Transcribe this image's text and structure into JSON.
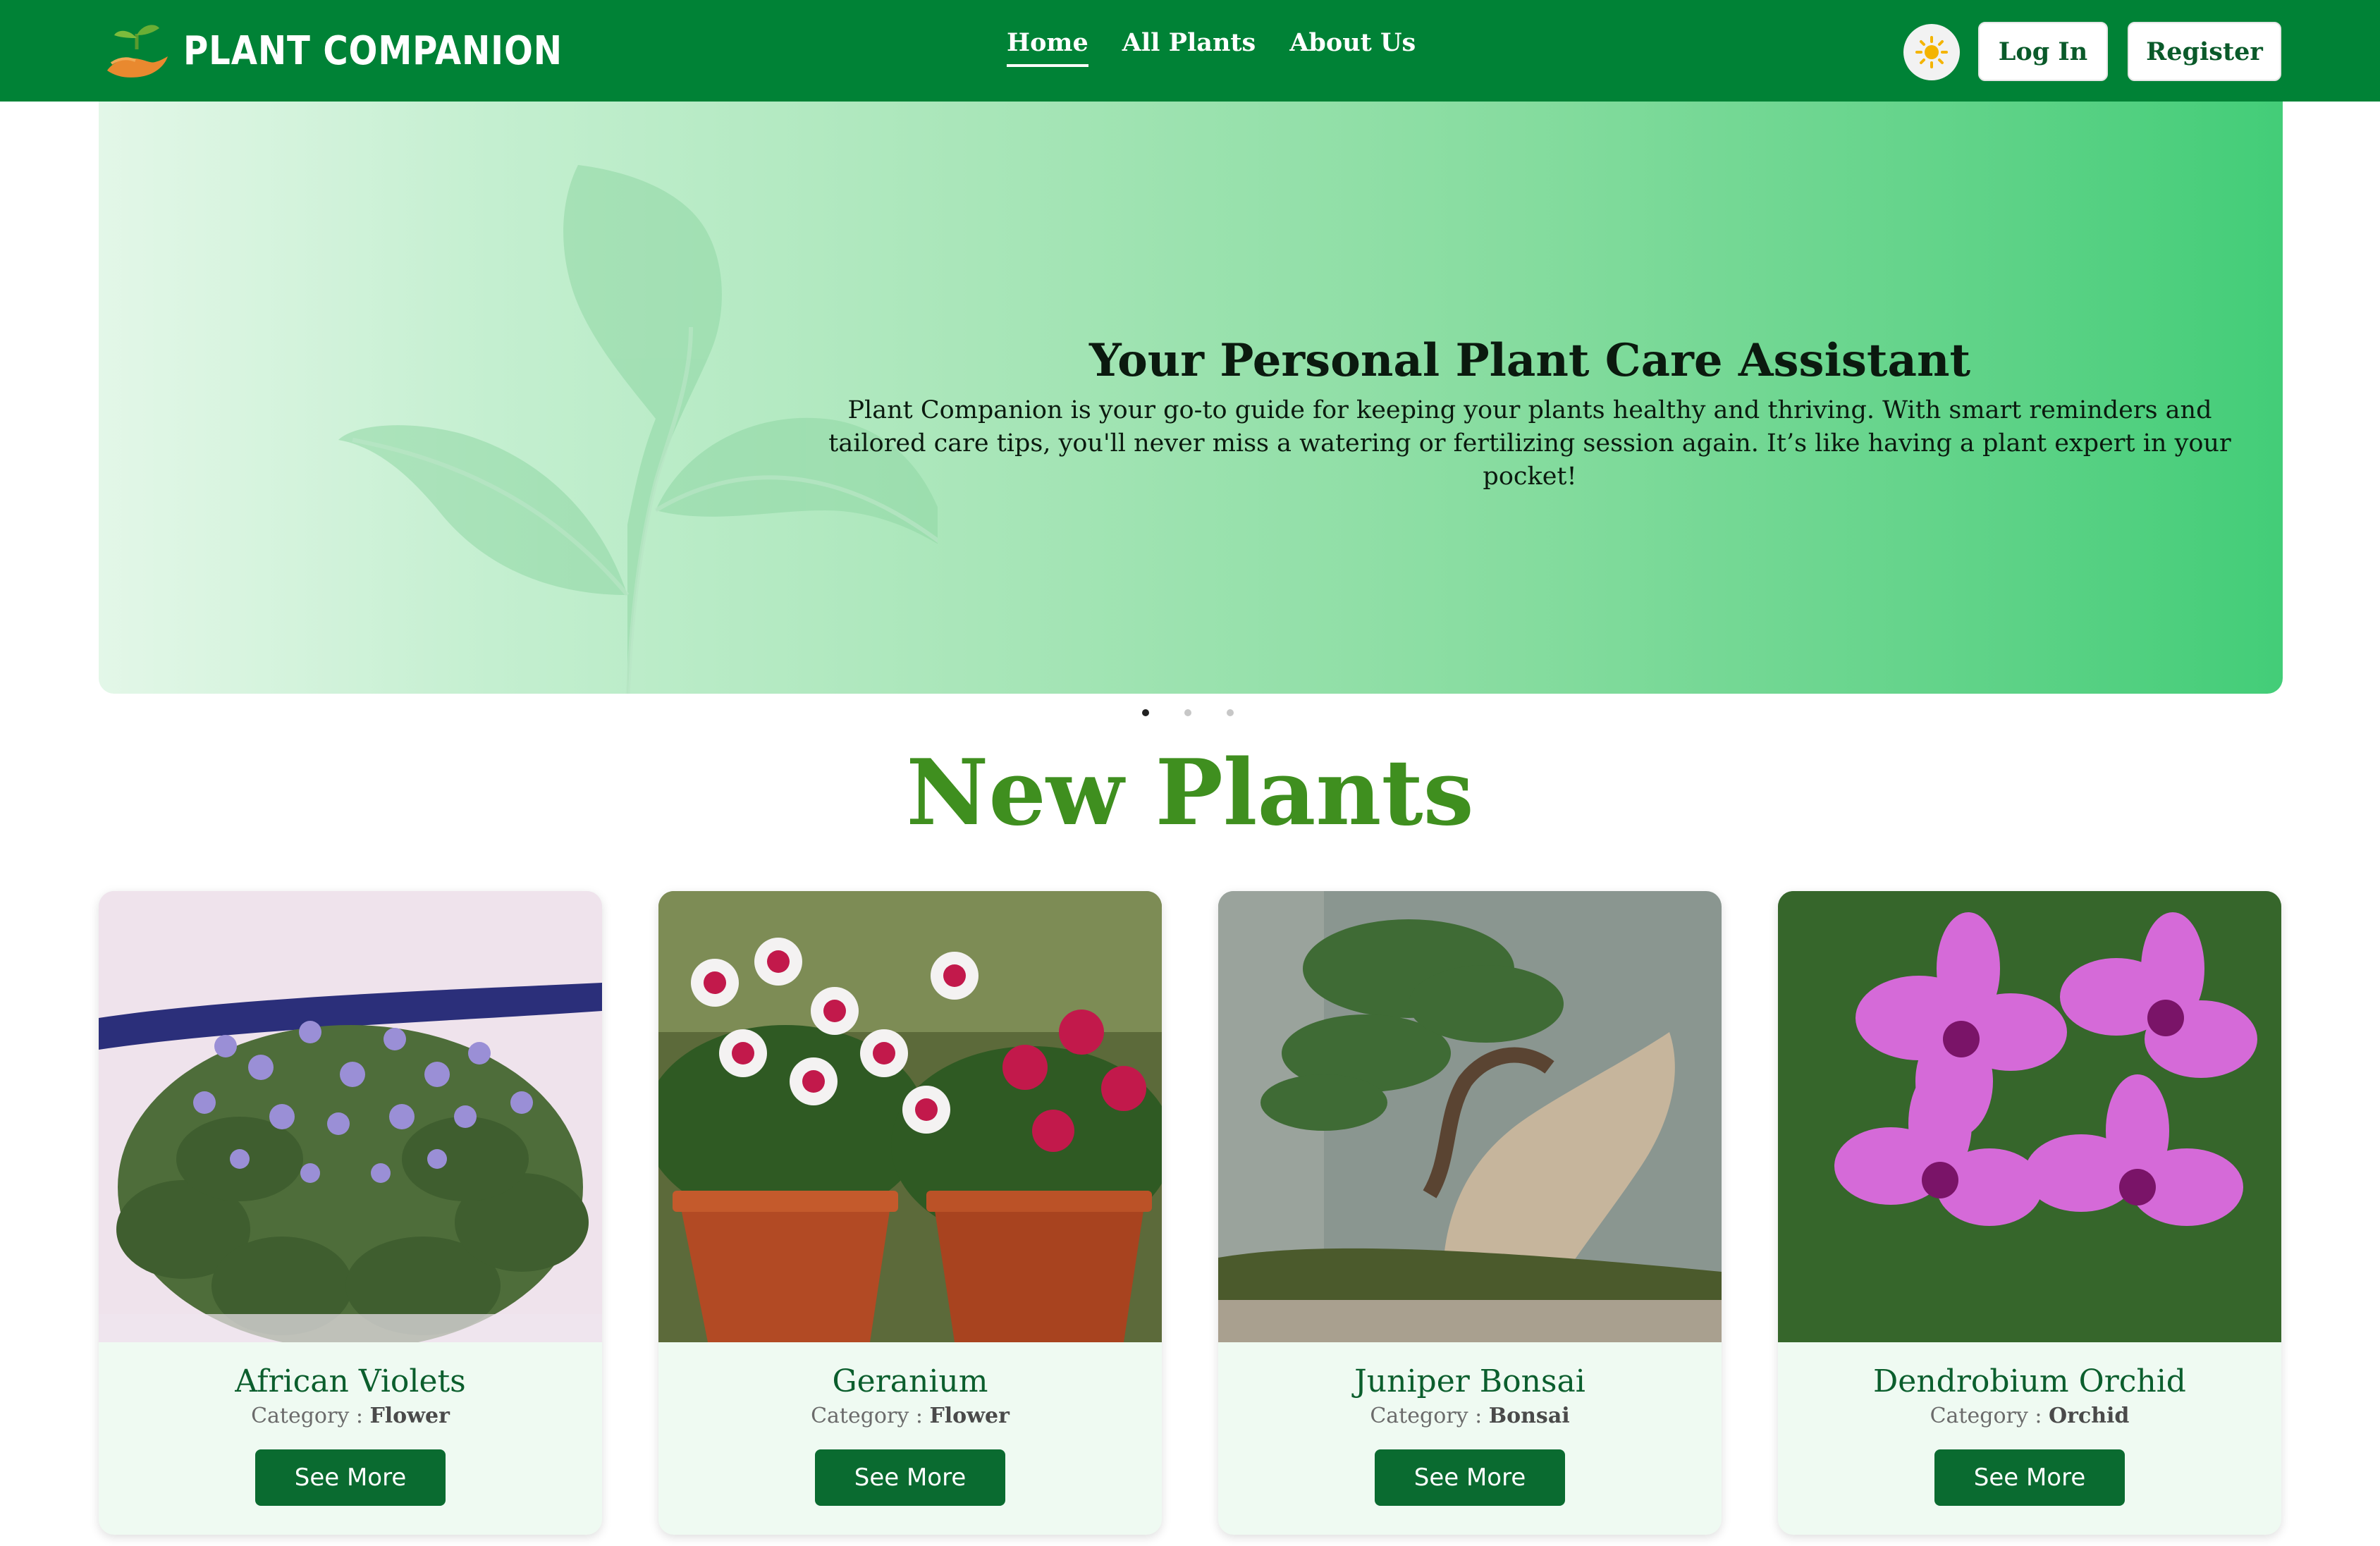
{
  "nav": {
    "brand_name": "PLANT COMPANION",
    "links": [
      {
        "label": "Home",
        "active": true
      },
      {
        "label": "All Plants",
        "active": false
      },
      {
        "label": "About Us",
        "active": false
      }
    ],
    "theme_icon": "sun-icon",
    "login_label": "Log In",
    "register_label": "Register"
  },
  "hero": {
    "title": "Your Personal Plant Care Assistant",
    "description": "Plant Companion is your go-to guide for keeping your plants healthy and thriving. With smart reminders and tailored care tips, you'll never miss a watering or fertilizing session again. It’s like having a plant expert in your pocket!",
    "slide_count": 3,
    "active_slide": 1
  },
  "new_plants": {
    "title": "New Plants",
    "category_label": "Category :",
    "button_label": "See More",
    "items": [
      {
        "name": "African Violets",
        "category": "Flower"
      },
      {
        "name": "Geranium",
        "category": "Flower"
      },
      {
        "name": "Juniper Bonsai",
        "category": "Bonsai"
      },
      {
        "name": "Dendrobium Orchid",
        "category": "Orchid"
      }
    ]
  },
  "colors": {
    "nav_bg": "#008236",
    "accent_title": "#3f8f1f",
    "button_bg": "#0a6b30",
    "card_bg": "#effaf2"
  }
}
